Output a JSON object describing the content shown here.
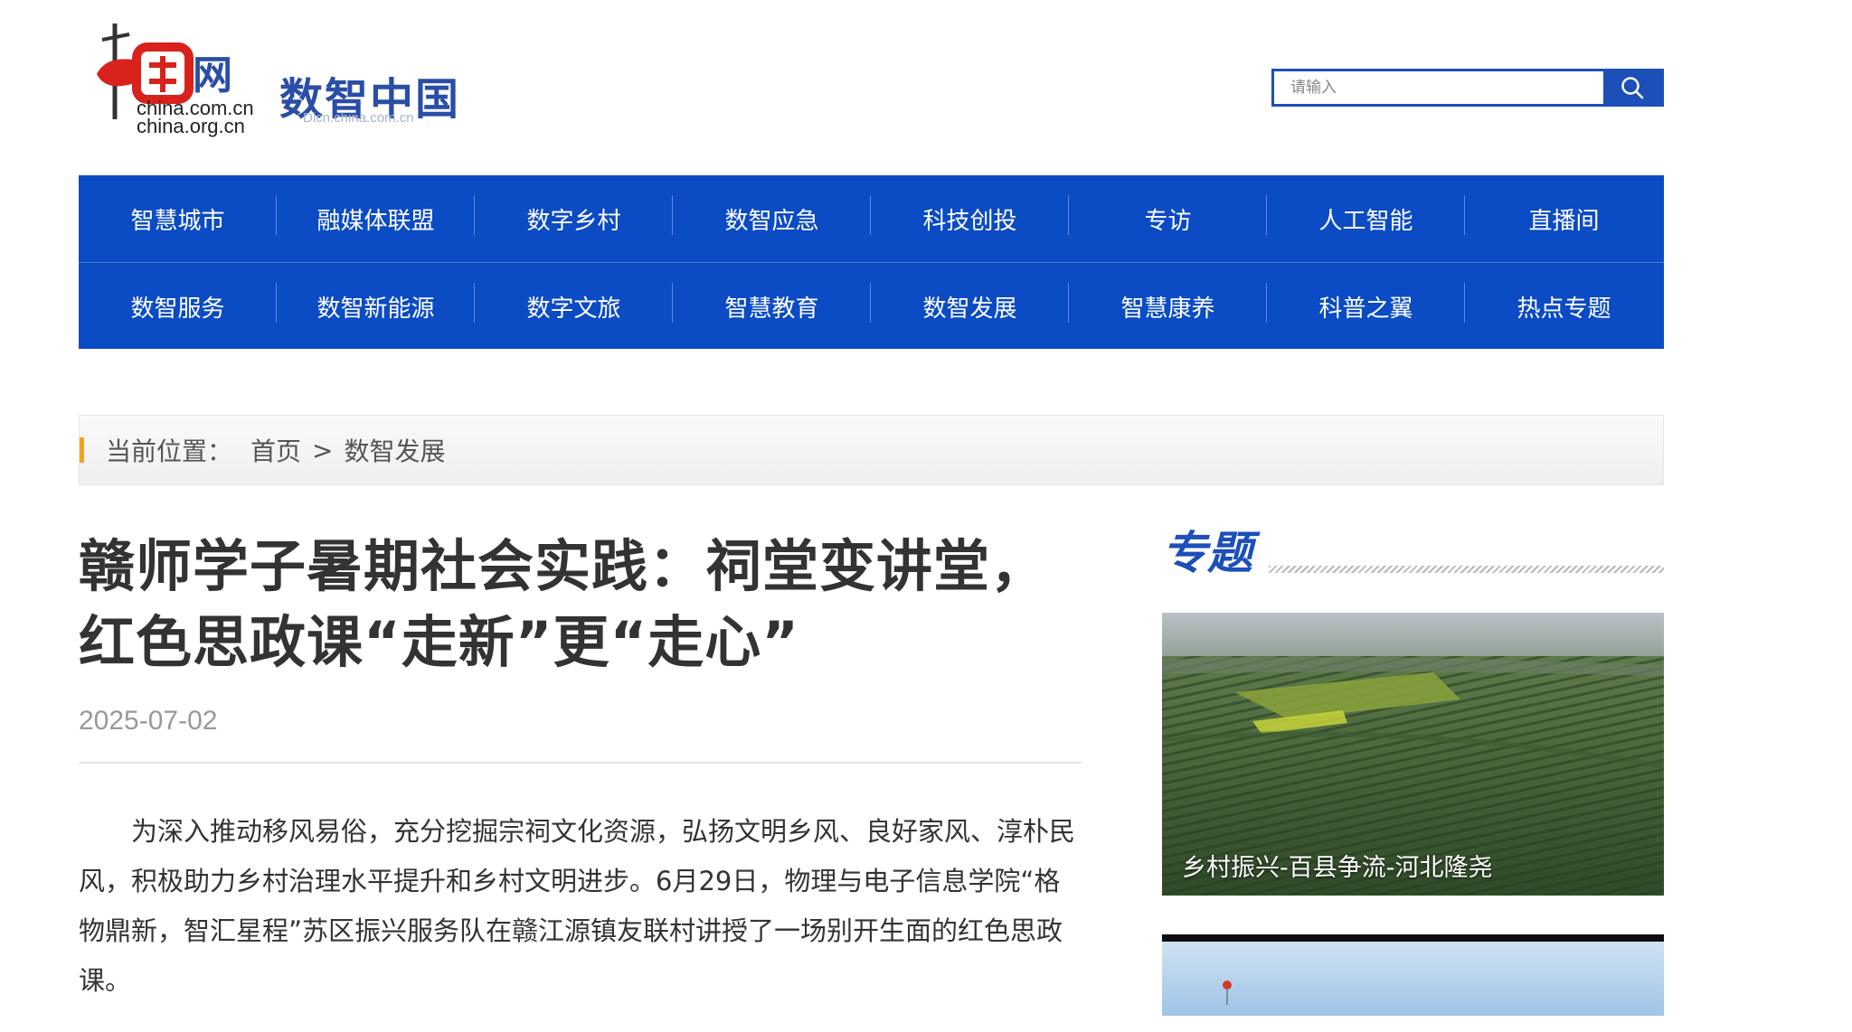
{
  "header": {
    "logo_domains": [
      "china.com.cn",
      "china.org.cn"
    ],
    "site_title": "数智中国",
    "site_subtitle": "Dicn.china.com.cn",
    "search": {
      "placeholder": "请输入",
      "icon": "search-icon"
    }
  },
  "nav": {
    "row1": [
      "智慧城市",
      "融媒体联盟",
      "数字乡村",
      "数智应急",
      "科技创投",
      "专访",
      "人工智能",
      "直播间"
    ],
    "row2": [
      "数智服务",
      "数智新能源",
      "数字文旅",
      "智慧教育",
      "数智发展",
      "智慧康养",
      "科普之翼",
      "热点专题"
    ]
  },
  "breadcrumb": {
    "label": "当前位置：",
    "home": "首页",
    "separator": ">",
    "current": "数智发展"
  },
  "article": {
    "title": "赣师学子暑期社会实践：祠堂变讲堂，红色思政课“走新”更“走心”",
    "date": "2025-07-02",
    "paragraph": "为深入推动移风易俗，充分挖掘宗祠文化资源，弘扬文明乡风、良好家风、淳朴民风，积极助力乡村治理水平提升和乡村文明进步。6月29日，物理与电子信息学院“格物鼎新，智汇星程”苏区振兴服务队在赣江源镇友联村讲授了一场别开生面的红色思政课。"
  },
  "sidebar": {
    "title": "专题",
    "cards": [
      {
        "caption": "乡村振兴-百县争流-河北隆尧"
      }
    ]
  },
  "colors": {
    "brand_blue": "#0b4bc4",
    "accent_orange": "#f0a31a",
    "logo_red": "#d8221b"
  }
}
